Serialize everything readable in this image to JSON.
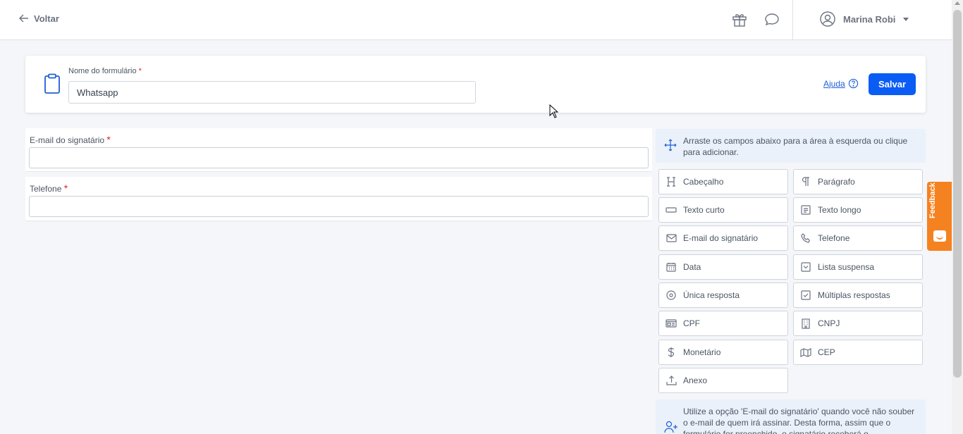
{
  "header": {
    "back_label": "Voltar",
    "user_name": "Marina Robi"
  },
  "form_header": {
    "name_label": "Nome do formulário",
    "name_required": "*",
    "name_value": "Whatsapp",
    "help_label": "Ajuda",
    "save_label": "Salvar"
  },
  "fields": [
    {
      "label": "E-mail do signatário",
      "required": "*"
    },
    {
      "label": "Telefone",
      "required": "*"
    }
  ],
  "palette": {
    "instructions": "Arraste os campos abaixo para a área à esquerda ou clique para adicionar.",
    "items": [
      {
        "label": "Cabeçalho",
        "icon": "heading-icon"
      },
      {
        "label": "Parágrafo",
        "icon": "paragraph-icon"
      },
      {
        "label": "Texto curto",
        "icon": "short-text-icon"
      },
      {
        "label": "Texto longo",
        "icon": "long-text-icon"
      },
      {
        "label": "E-mail do signatário",
        "icon": "envelope-icon"
      },
      {
        "label": "Telefone",
        "icon": "phone-icon"
      },
      {
        "label": "Data",
        "icon": "calendar-icon"
      },
      {
        "label": "Lista suspensa",
        "icon": "dropdown-icon"
      },
      {
        "label": "Única resposta",
        "icon": "radio-icon"
      },
      {
        "label": "Múltiplas respostas",
        "icon": "checkbox-icon"
      },
      {
        "label": "CPF",
        "icon": "id-card-icon"
      },
      {
        "label": "CNPJ",
        "icon": "building-icon"
      },
      {
        "label": "Monetário",
        "icon": "dollar-icon"
      },
      {
        "label": "CEP",
        "icon": "map-icon"
      },
      {
        "label": "Anexo",
        "icon": "upload-icon"
      }
    ],
    "note": "Utilize a opção 'E-mail do signatário' quando você não souber o e-mail de quem irá assinar. Desta forma, assim que o formulário for preenchido, o signatário receberá o"
  },
  "feedback_label": "Feedback",
  "colors": {
    "primary": "#0a5cf5",
    "feedback": "#f58220",
    "required": "#e02424"
  }
}
